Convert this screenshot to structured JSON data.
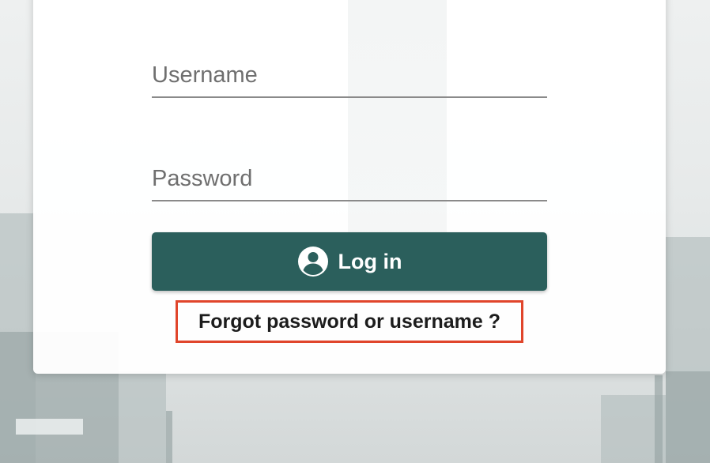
{
  "login_form": {
    "username": {
      "placeholder": "Username",
      "value": ""
    },
    "password": {
      "placeholder": "Password",
      "value": ""
    },
    "login_button": {
      "label": "Log in",
      "icon": "account-circle-icon"
    },
    "forgot_link": {
      "label": "Forgot password or username ?",
      "highlight_color": "#e0452b"
    }
  },
  "colors": {
    "primary": "#2b5f5c",
    "card_background": "#ffffff",
    "underline": "#8a8a8a"
  }
}
